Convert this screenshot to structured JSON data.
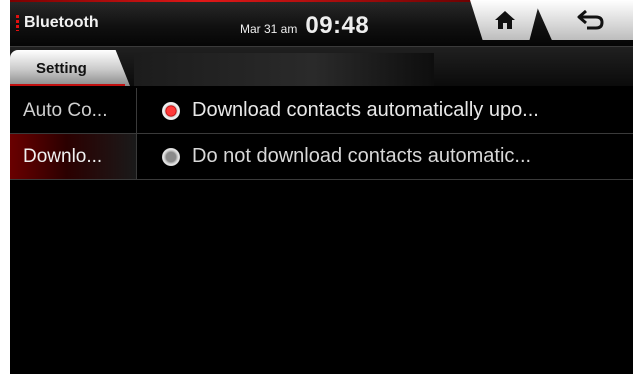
{
  "header": {
    "app_title": "Bluetooth",
    "date": "Mar 31 am",
    "time": "09:48"
  },
  "nav": {
    "home_icon": "home-icon",
    "back_icon": "back-arrow-icon"
  },
  "tabs": [
    {
      "label": "Setting",
      "active": true
    }
  ],
  "settings": [
    {
      "label": "Auto Co...",
      "option": "Download contacts automatically upo...",
      "selected": true
    },
    {
      "label": "Downlo...",
      "option": "Do not download contacts automatic...",
      "selected": false,
      "highlighted": true
    }
  ],
  "colors": {
    "accent": "#c01010",
    "background": "#000000"
  }
}
